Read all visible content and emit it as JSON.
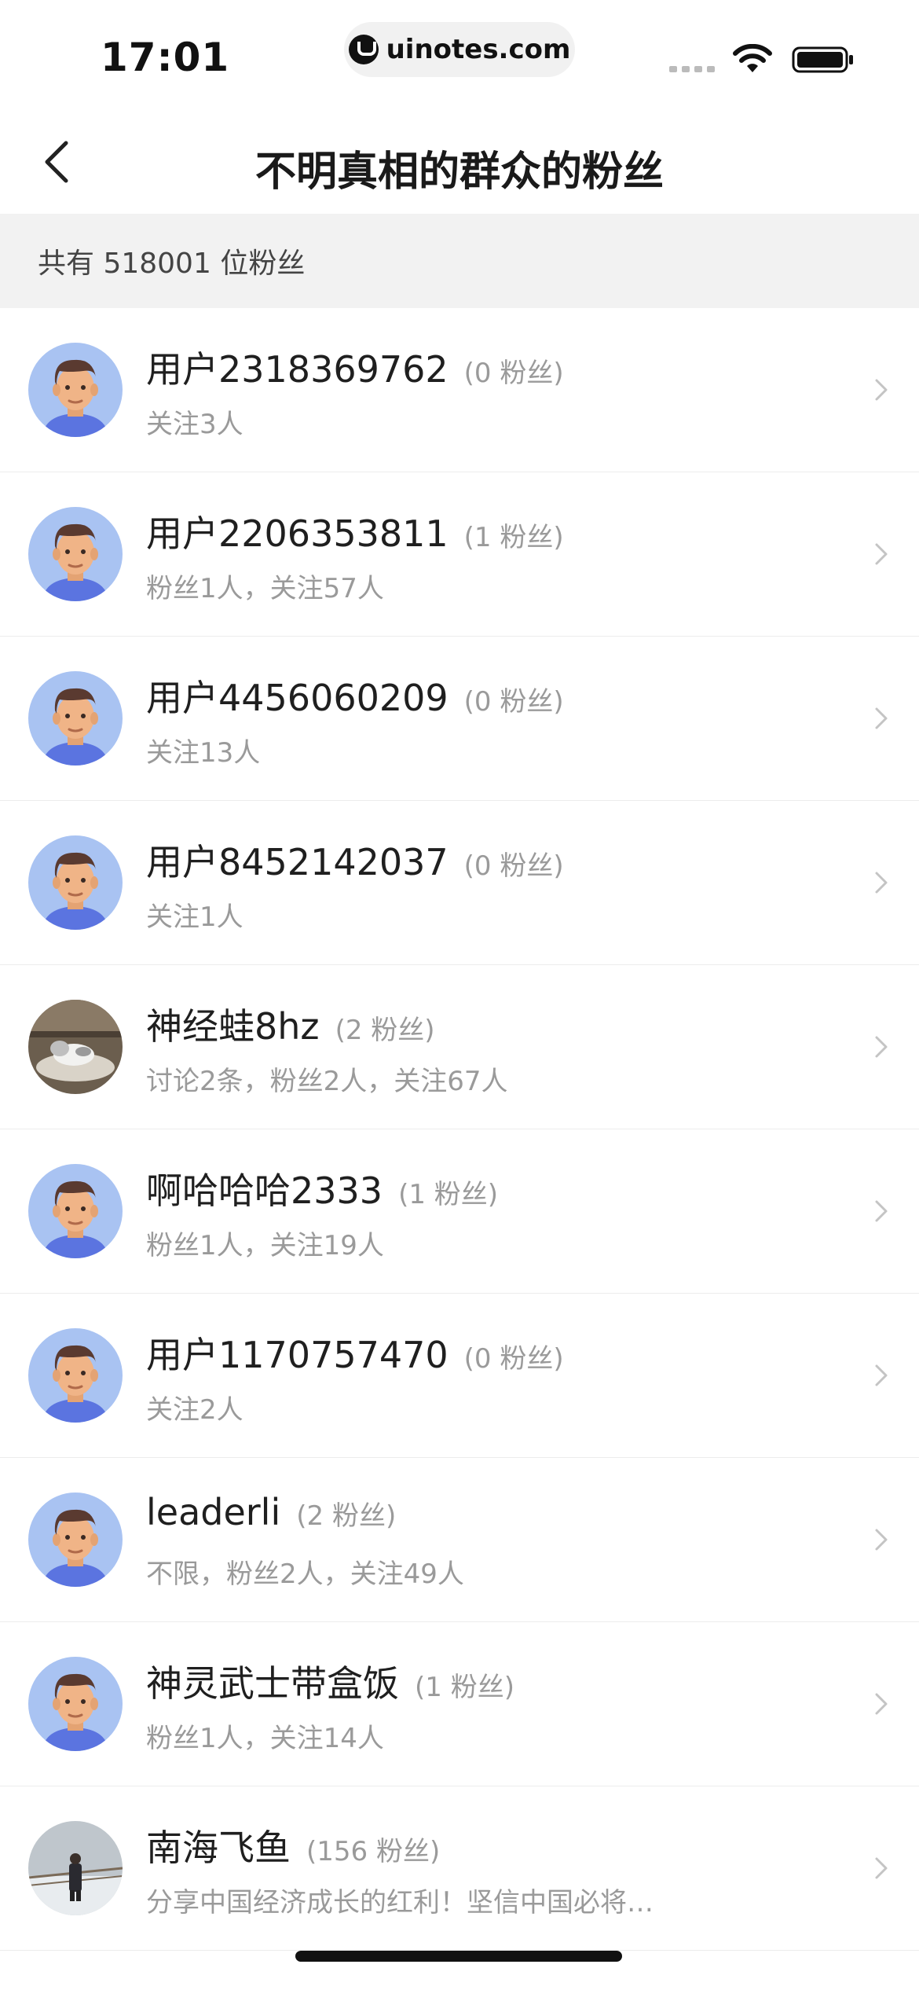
{
  "status_bar": {
    "time": "17:01",
    "url": "uinotes.com"
  },
  "nav": {
    "title": "不明真相的群众的粉丝"
  },
  "header": {
    "count_text": "共有 518001 位粉丝"
  },
  "followers": [
    {
      "name": "用户2318369762",
      "fans": "(0 粉丝)",
      "sub": "关注3人",
      "avatar": "cartoon"
    },
    {
      "name": "用户2206353811",
      "fans": "(1 粉丝)",
      "sub": "粉丝1人，关注57人",
      "avatar": "cartoon"
    },
    {
      "name": "用户4456060209",
      "fans": "(0 粉丝)",
      "sub": "关注13人",
      "avatar": "cartoon"
    },
    {
      "name": "用户8452142037",
      "fans": "(0 粉丝)",
      "sub": "关注1人",
      "avatar": "cartoon"
    },
    {
      "name": "神经蛙8hz",
      "fans": "(2 粉丝)",
      "sub": "讨论2条，粉丝2人，关注67人",
      "avatar": "cat-photo"
    },
    {
      "name": "啊哈哈哈2333",
      "fans": "(1 粉丝)",
      "sub": "粉丝1人，关注19人",
      "avatar": "cartoon"
    },
    {
      "name": "用户1170757470",
      "fans": "(0 粉丝)",
      "sub": "关注2人",
      "avatar": "cartoon"
    },
    {
      "name": "leaderli",
      "fans": "(2 粉丝)",
      "sub": "不限，粉丝2人，关注49人",
      "avatar": "cartoon"
    },
    {
      "name": "神灵武士带盒饭",
      "fans": "(1 粉丝)",
      "sub": "粉丝1人，关注14人",
      "avatar": "cartoon"
    },
    {
      "name": "南海飞鱼",
      "fans": "(156 粉丝)",
      "sub": "分享中国经济成长的红利！坚信中国必将…",
      "avatar": "person-photo"
    }
  ]
}
